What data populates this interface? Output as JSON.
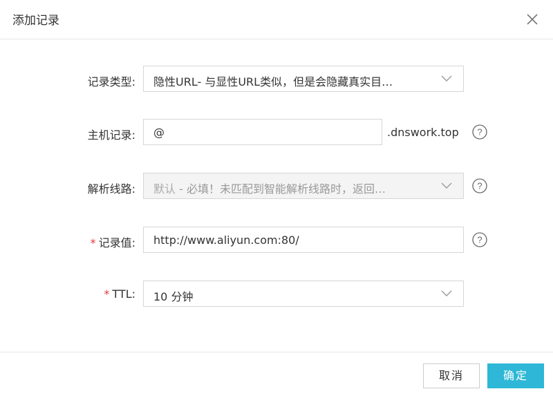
{
  "dialog": {
    "title": "添加记录"
  },
  "form": {
    "record_type": {
      "label": "记录类型:",
      "value": "隐性URL- 与显性URL类似，但是会隐藏真实目…"
    },
    "host": {
      "label": "主机记录:",
      "value": "@",
      "suffix": ".dnswork.top"
    },
    "line": {
      "label": "解析线路:",
      "value_main": "默认",
      "value_rest": " - 必填！未匹配到智能解析线路时，返回…"
    },
    "record_value": {
      "required_mark": "*",
      "label": "记录值:",
      "value": "http://www.aliyun.com:80/"
    },
    "ttl": {
      "required_mark": "*",
      "label": "TTL:",
      "value": "10 分钟"
    }
  },
  "footer": {
    "cancel_label": "取消",
    "ok_label": "确定"
  },
  "colors": {
    "primary": "#2eb7d6",
    "required": "#e4393c"
  }
}
